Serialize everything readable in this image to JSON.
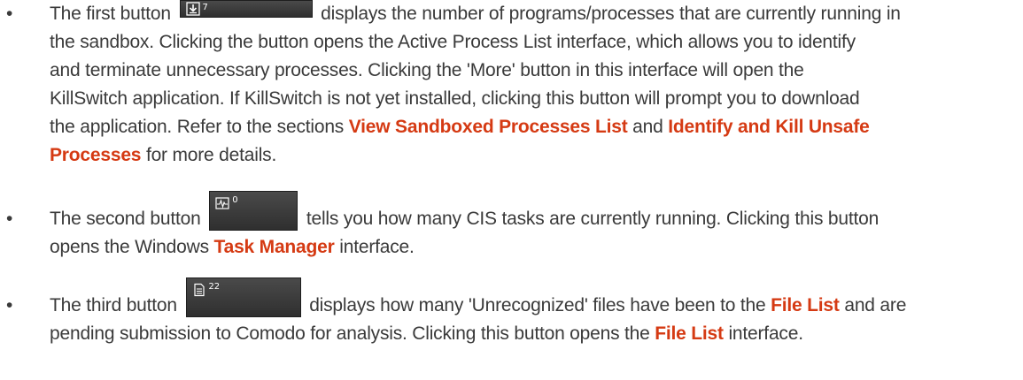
{
  "bullet_glyph": "•",
  "items": [
    {
      "pre_button": "The first button",
      "button_count": "7",
      "button_icon": "download-box-icon",
      "line1_post": "displays the number of programs/processes that are currently running in",
      "line2": "the sandbox. Clicking the button opens the Active Process List interface, which allows you to identify",
      "line3": "and terminate unnecessary processes. Clicking the 'More' button in this interface will open the",
      "line4": "KillSwitch application. If KillSwitch is not yet installed, clicking this button will prompt you to download",
      "line5_pre": "the application. Refer to the sections",
      "link1": "View Sandboxed Processes List",
      "line5_mid": "and",
      "link2": "Identify and Kill Unsafe",
      "link2_cont": "Processes",
      "line6_post": "for more details."
    },
    {
      "pre_button": "The second button",
      "button_count": "0",
      "button_icon": "pulse-monitor-icon",
      "line1_post": "tells you how many CIS tasks are currently running. Clicking this button",
      "line2_pre": "opens the Windows",
      "link1": "Task Manager",
      "line2_post": "interface."
    },
    {
      "pre_button": "The third button",
      "button_count": "22",
      "button_icon": "document-icon",
      "line1_pre": "displays how many 'Unrecognized' files have been to the",
      "link1": "File List",
      "line1_post": "and are",
      "line2_pre": "pending submission to Comodo for analysis. Clicking this button opens the",
      "link2": "File List",
      "line2_post": "interface."
    }
  ],
  "colors": {
    "text": "#3a3a3a",
    "link": "#d53a13",
    "button_bg": "#3a3a3a"
  }
}
